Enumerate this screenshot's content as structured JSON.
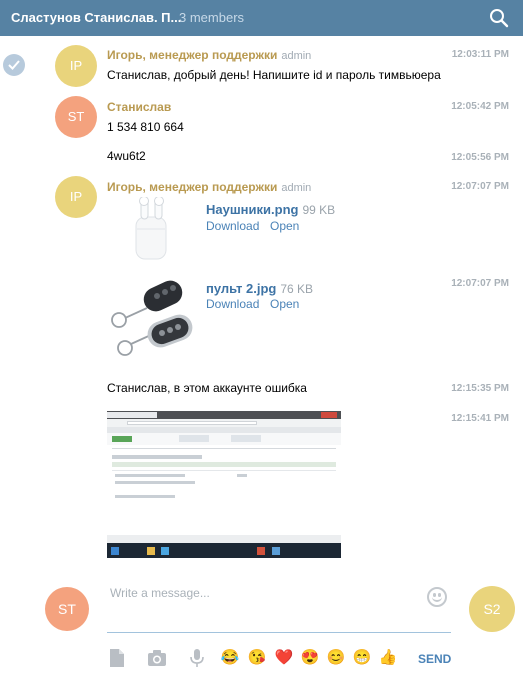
{
  "header": {
    "title": "Сластунов Станислав. П...",
    "members": "3 members"
  },
  "messages": [
    {
      "initials": "IP",
      "sender": "Игорь, менеджер поддержки",
      "role": "admin",
      "time": "12:03:11 PM",
      "text": "Станислав, добрый день! Напишите id и пароль тимвьюера"
    },
    {
      "initials": "ST",
      "sender": "Станислав",
      "time": "12:05:42 PM",
      "text": "1 534 810 664"
    },
    {
      "time": "12:05:56 PM",
      "text": "4wu6t2"
    },
    {
      "initials": "IP",
      "sender": "Игорь, менеджер поддержки",
      "role": "admin",
      "time": "12:07:07 PM",
      "file": {
        "name": "Наушники.png",
        "size": "99 KB",
        "download": "Download",
        "open": "Open"
      }
    },
    {
      "time": "12:07:07 PM",
      "file": {
        "name": "пульт 2.jpg",
        "size": "76 KB",
        "download": "Download",
        "open": "Open"
      }
    },
    {
      "time": "12:15:35 PM",
      "text": "Станислав, в этом аккаунте ошибка"
    },
    {
      "time": "12:15:41 PM"
    }
  ],
  "composer": {
    "placeholder": "Write a message...",
    "my_initials": "ST",
    "peer_initials": "S2",
    "send_label": "SEND",
    "quick_emoji": [
      "😂",
      "😘",
      "❤️",
      "😍",
      "😊",
      "😁",
      "👍"
    ]
  },
  "colors": {
    "header": "#5682a3",
    "sender": "#b99a51",
    "link": "#4b83b7",
    "avatar_ip": "#e9d47c",
    "avatar_st": "#f4a27e"
  }
}
